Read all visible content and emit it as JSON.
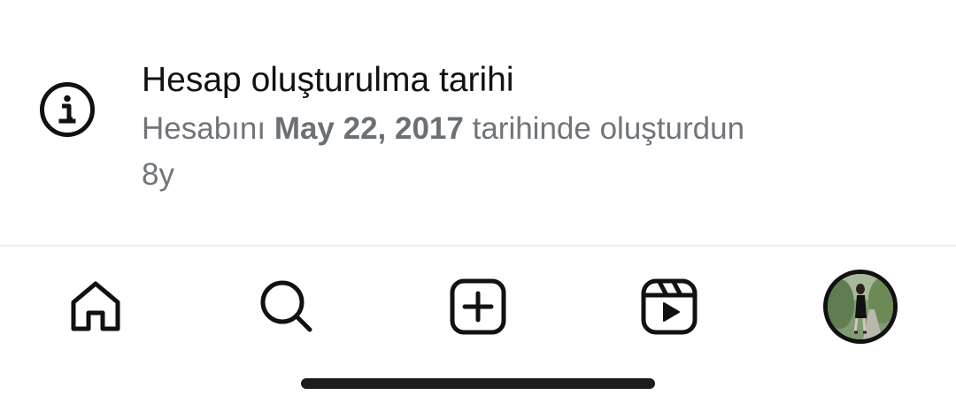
{
  "info": {
    "icon": "info-icon",
    "title": "Hesap oluşturulma tarihi",
    "desc_prefix": "Hesabını ",
    "date": "May 22, 2017",
    "desc_suffix": " tarihinde oluşturdun",
    "age": "8y"
  },
  "nav": {
    "items": [
      {
        "icon": "home-icon"
      },
      {
        "icon": "search-icon"
      },
      {
        "icon": "create-icon"
      },
      {
        "icon": "reels-icon"
      },
      {
        "icon": "profile-avatar"
      }
    ]
  },
  "colors": {
    "primary_text": "#111111",
    "secondary_text": "#70757a",
    "divider": "#ececec",
    "home_indicator": "#1c1c1c"
  }
}
